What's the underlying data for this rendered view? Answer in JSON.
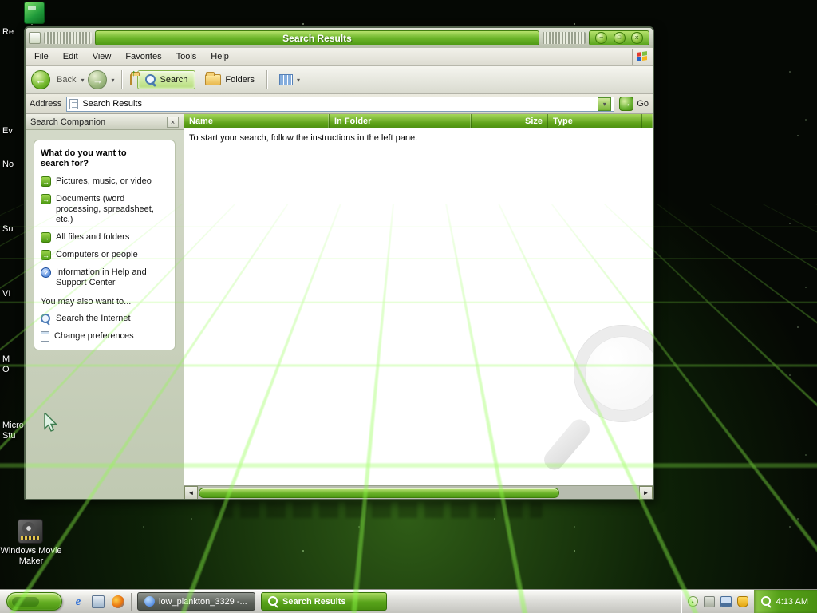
{
  "colors": {
    "accent_green": "#5aa51c",
    "titlebar_green_light": "#b6e26c",
    "titlebar_green_dark": "#4f9a15",
    "taskbar_silver": "#d8d8d0"
  },
  "desktop": {
    "icon_labels": [
      {
        "label": "Re"
      },
      {
        "label": "Ev"
      },
      {
        "label": "No"
      },
      {
        "label": "Su"
      },
      {
        "label": "VI"
      },
      {
        "label": "M\nO"
      },
      {
        "label": "Micro\nStu"
      }
    ],
    "movie_maker": {
      "label": "Windows Movie\nMaker"
    }
  },
  "window": {
    "title": "Search Results",
    "menubar": {
      "items": [
        {
          "label": "File"
        },
        {
          "label": "Edit"
        },
        {
          "label": "View"
        },
        {
          "label": "Favorites"
        },
        {
          "label": "Tools"
        },
        {
          "label": "Help"
        }
      ]
    },
    "toolbar": {
      "back_label": "Back",
      "search_label": "Search",
      "folders_label": "Folders"
    },
    "addressbar": {
      "label": "Address",
      "value": "Search Results",
      "go_label": "Go"
    },
    "search_companion": {
      "title": "Search Companion",
      "heading": "What do you want to search for?",
      "links": [
        {
          "label": "Pictures, music, or video"
        },
        {
          "label": "Documents (word processing, spreadsheet, etc.)"
        },
        {
          "label": "All files and folders"
        },
        {
          "label": "Computers or people"
        },
        {
          "label": "Information in Help and Support Center"
        }
      ],
      "also_heading": "You may also want to...",
      "also_links": [
        {
          "label": "Search the Internet"
        },
        {
          "label": "Change preferences"
        }
      ]
    },
    "listview": {
      "columns": [
        {
          "label": "Name"
        },
        {
          "label": "In Folder"
        },
        {
          "label": "Size"
        },
        {
          "label": "Type"
        }
      ],
      "message": "To start your search, follow the instructions in the left pane."
    }
  },
  "taskbar": {
    "tasks": [
      {
        "label": "low_plankton_3329 -...",
        "active": false
      },
      {
        "label": "Search Results",
        "active": true
      }
    ],
    "clock": "4:13 AM"
  }
}
